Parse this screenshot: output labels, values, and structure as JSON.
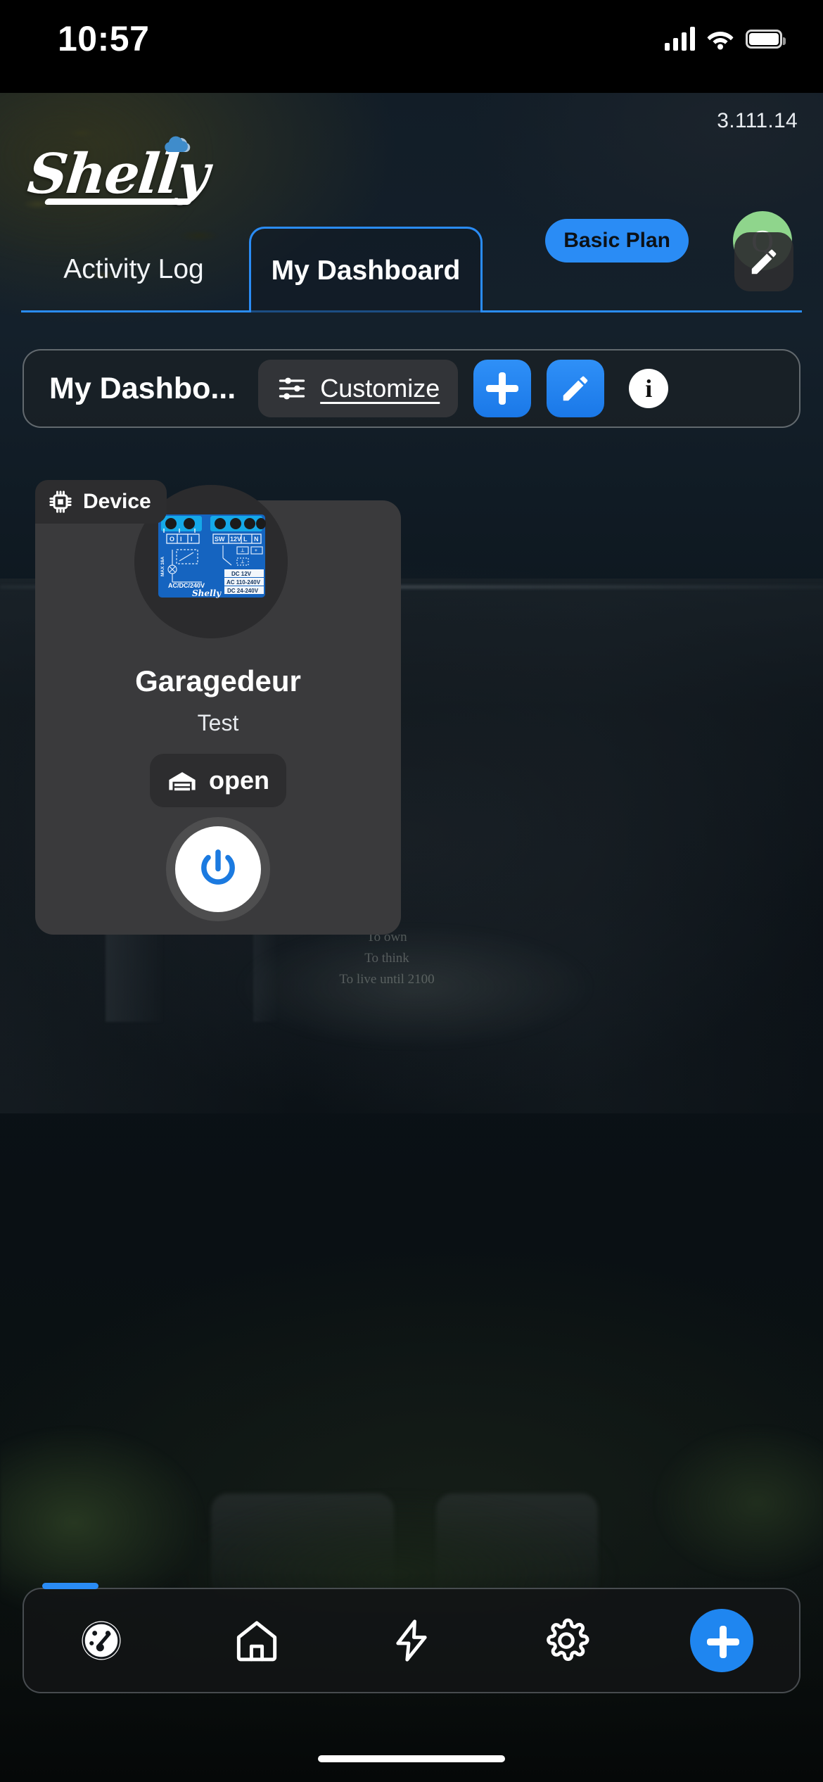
{
  "status_bar": {
    "time": "10:57",
    "icons": [
      "cellular-signal-icon",
      "wifi-icon",
      "battery-icon"
    ]
  },
  "header": {
    "app_version": "3.111.14",
    "logo_text": "Shelly",
    "logo_icon": "cloud-icon",
    "plan_label": "Basic Plan",
    "avatar_initial": "Q",
    "edit_button_icon": "pencil-icon"
  },
  "tabs": [
    {
      "label": "Activity Log",
      "active": false
    },
    {
      "label": "My Dashboard",
      "active": true
    }
  ],
  "toolbar": {
    "title": "My Dashbo...",
    "customize_label": "Customize",
    "customize_icon": "sliders-icon",
    "add_label": "+",
    "edit_icon": "pencil-icon",
    "info_label": "i"
  },
  "device_card": {
    "badge_label": "Device",
    "badge_icon": "chip-icon",
    "name": "Garagedeur",
    "subtitle": "Test",
    "state_label": "open",
    "state_icon": "garage-door-icon",
    "power_button_icon": "power-icon",
    "image_labels": {
      "left_terminals": "O  I  I",
      "right_terminals": "SW 12V L N",
      "max_current": "MAX 16A",
      "voltage_left": "AC/DC/240V",
      "spec_1": "DC 12V",
      "spec_2": "AC 110-240V",
      "spec_3": "DC 24-240V",
      "brand": "Shelly"
    }
  },
  "wallpaper": {
    "wall_text_line1": "To own",
    "wall_text_line2": "To think",
    "wall_text_line3": "To live until 2100"
  },
  "bottom_nav": {
    "items": [
      {
        "icon": "dashboard-gauge-icon",
        "name": "dashboard"
      },
      {
        "icon": "home-icon",
        "name": "home"
      },
      {
        "icon": "lightning-bolt-icon",
        "name": "automations"
      },
      {
        "icon": "gear-icon",
        "name": "settings"
      },
      {
        "icon": "plus-icon",
        "name": "add"
      }
    ]
  },
  "colors": {
    "accent_blue": "#2a8cf5",
    "avatar_green": "#8fd58c",
    "card_gray": "#3a3a3c",
    "badge_gray": "#2d2d2f"
  }
}
